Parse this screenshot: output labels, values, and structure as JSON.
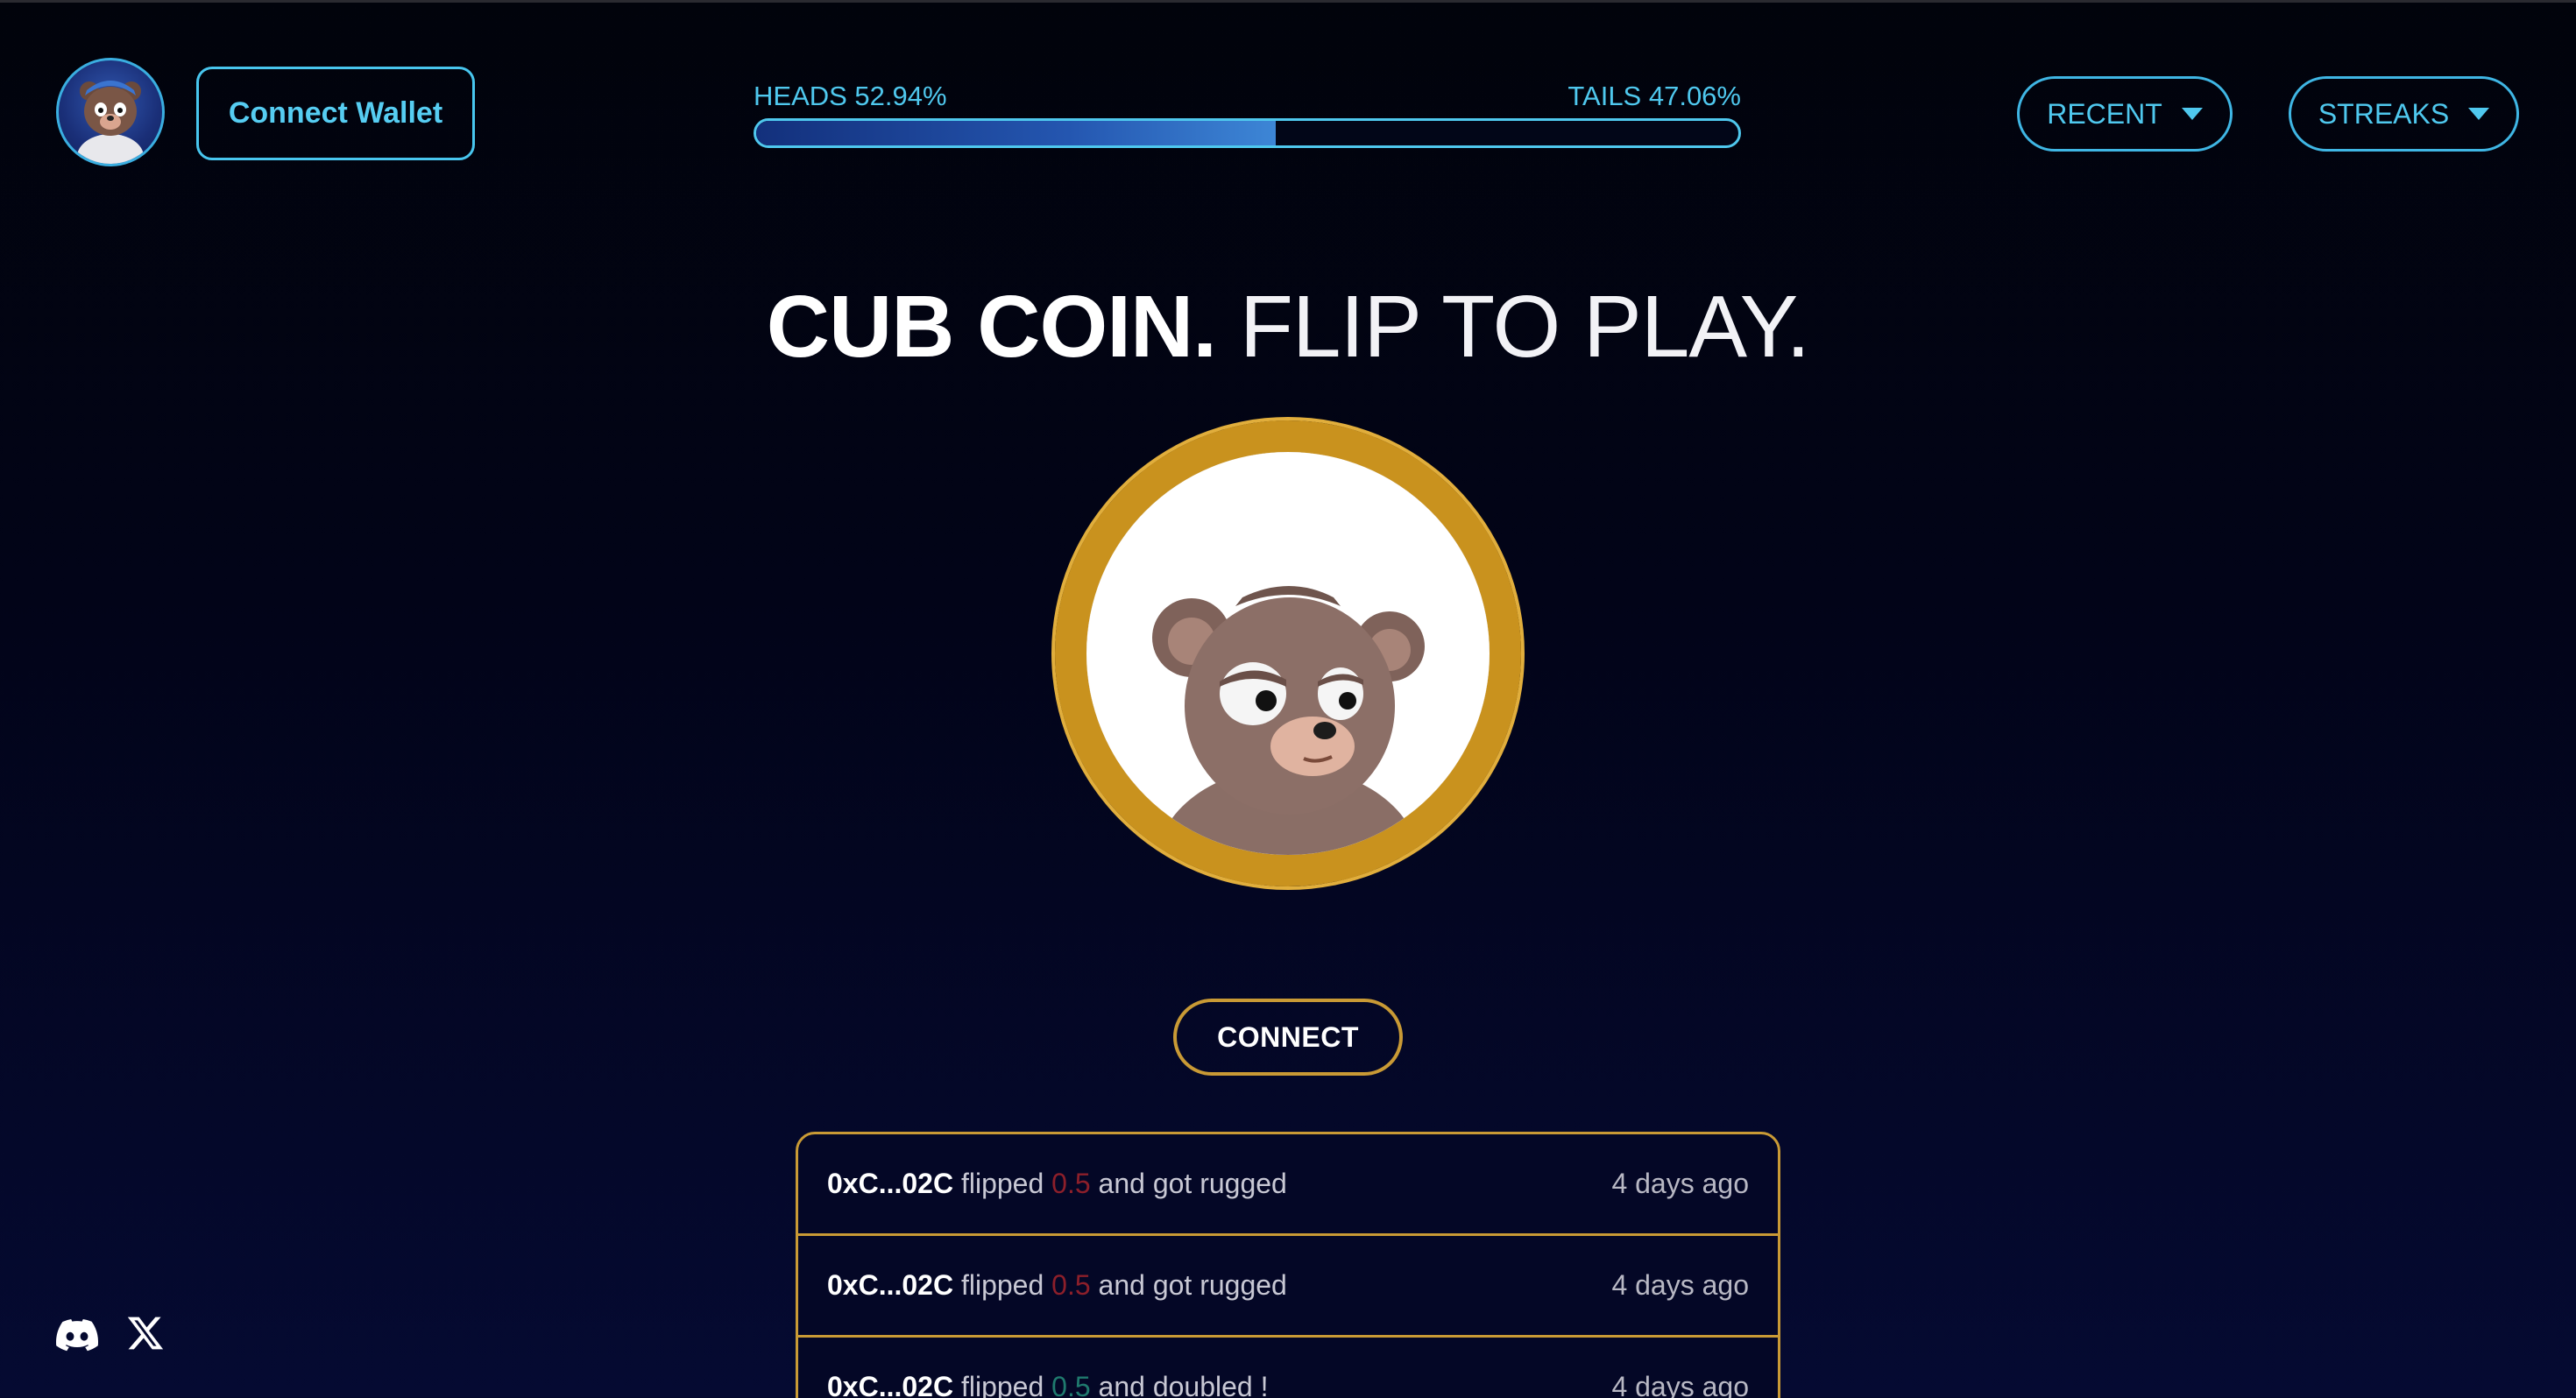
{
  "header": {
    "connect_wallet_label": "Connect Wallet",
    "heads_label": "HEADS 52.94%",
    "tails_label": "TAILS 47.06%",
    "heads_fraction": 0.5294,
    "recent_label": "RECENT",
    "streaks_label": "STREAKS"
  },
  "hero": {
    "title_bold": "CUB COIN.",
    "title_light": "FLIP TO PLAY."
  },
  "actions": {
    "connect_label": "CONNECT"
  },
  "feed": [
    {
      "address": "0xC...02C",
      "verb": "flipped",
      "amount": "0.5",
      "outcome": "and got rugged",
      "time": "4 days ago",
      "result": "lost"
    },
    {
      "address": "0xC...02C",
      "verb": "flipped",
      "amount": "0.5",
      "outcome": "and got rugged",
      "time": "4 days ago",
      "result": "lost"
    },
    {
      "address": "0xC...02C",
      "verb": "flipped",
      "amount": "0.5",
      "outcome": "and doubled !",
      "time": "4 days ago",
      "result": "won"
    }
  ],
  "icons": {
    "avatar": "bear-avatar",
    "coin": "bear-coin",
    "discord": "discord-icon",
    "x": "x-icon"
  },
  "colors": {
    "accent": "#4fc8ee",
    "gold": "#c99a35",
    "lost": "#8c1f2a",
    "won": "#1f7a6e"
  }
}
